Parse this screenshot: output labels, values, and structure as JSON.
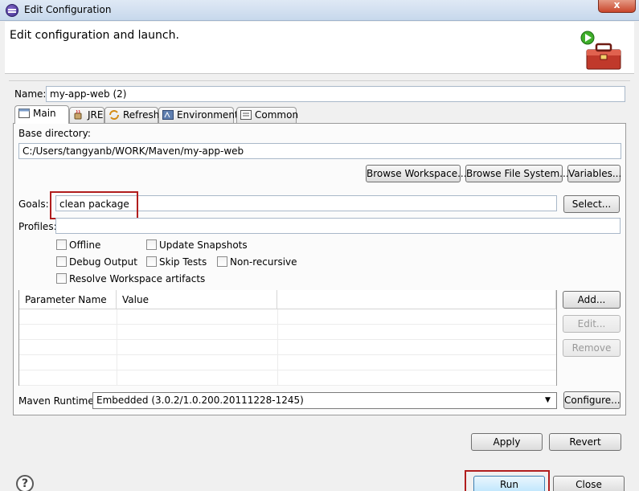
{
  "window": {
    "title": "Edit Configuration",
    "close_symbol": "x",
    "app_icon": "eclipse-icon"
  },
  "header": {
    "text": "Edit configuration and launch.",
    "icon": "maven-toolbox-run-icon"
  },
  "name": {
    "label": "Name:",
    "value": "my-app-web (2)"
  },
  "tabs": [
    {
      "label": "Main",
      "icon": "main-tab-icon",
      "active": true
    },
    {
      "label": "JRE",
      "icon": "jre-icon",
      "active": false
    },
    {
      "label": "Refresh",
      "icon": "refresh-icon",
      "active": false
    },
    {
      "label": "Environment",
      "icon": "environment-icon",
      "active": false
    },
    {
      "label": "Common",
      "icon": "common-icon",
      "active": false
    }
  ],
  "base_directory": {
    "label": "Base directory:",
    "value": "C:/Users/tangyanb/WORK/Maven/my-app-web",
    "buttons": [
      "Browse Workspace...",
      "Browse File System...",
      "Variables..."
    ]
  },
  "goals": {
    "label": "Goals:",
    "value": "clean package",
    "select_button": "Select..."
  },
  "profiles": {
    "label": "Profiles:",
    "value": ""
  },
  "options": [
    {
      "label": "Offline",
      "checked": false
    },
    {
      "label": "Update Snapshots",
      "checked": false
    },
    {
      "label": "Debug Output",
      "checked": false
    },
    {
      "label": "Skip Tests",
      "checked": false
    },
    {
      "label": "Non-recursive",
      "checked": false
    },
    {
      "label": "Resolve Workspace artifacts",
      "checked": false
    }
  ],
  "parameters": {
    "columns": [
      "Parameter Name",
      "Value"
    ],
    "rows": [],
    "buttons": {
      "add": "Add...",
      "edit": "Edit...",
      "remove": "Remove"
    }
  },
  "maven_runtime": {
    "label": "Maven Runtime:",
    "value": "Embedded (3.0.2/1.0.200.20111228-1245)",
    "configure_button": "Configure..."
  },
  "footer": {
    "apply": "Apply",
    "revert": "Revert",
    "run": "Run",
    "close": "Close",
    "help": "?"
  },
  "colors": {
    "highlight": "#b11e1e",
    "title_bar": "#c7d8ec"
  }
}
